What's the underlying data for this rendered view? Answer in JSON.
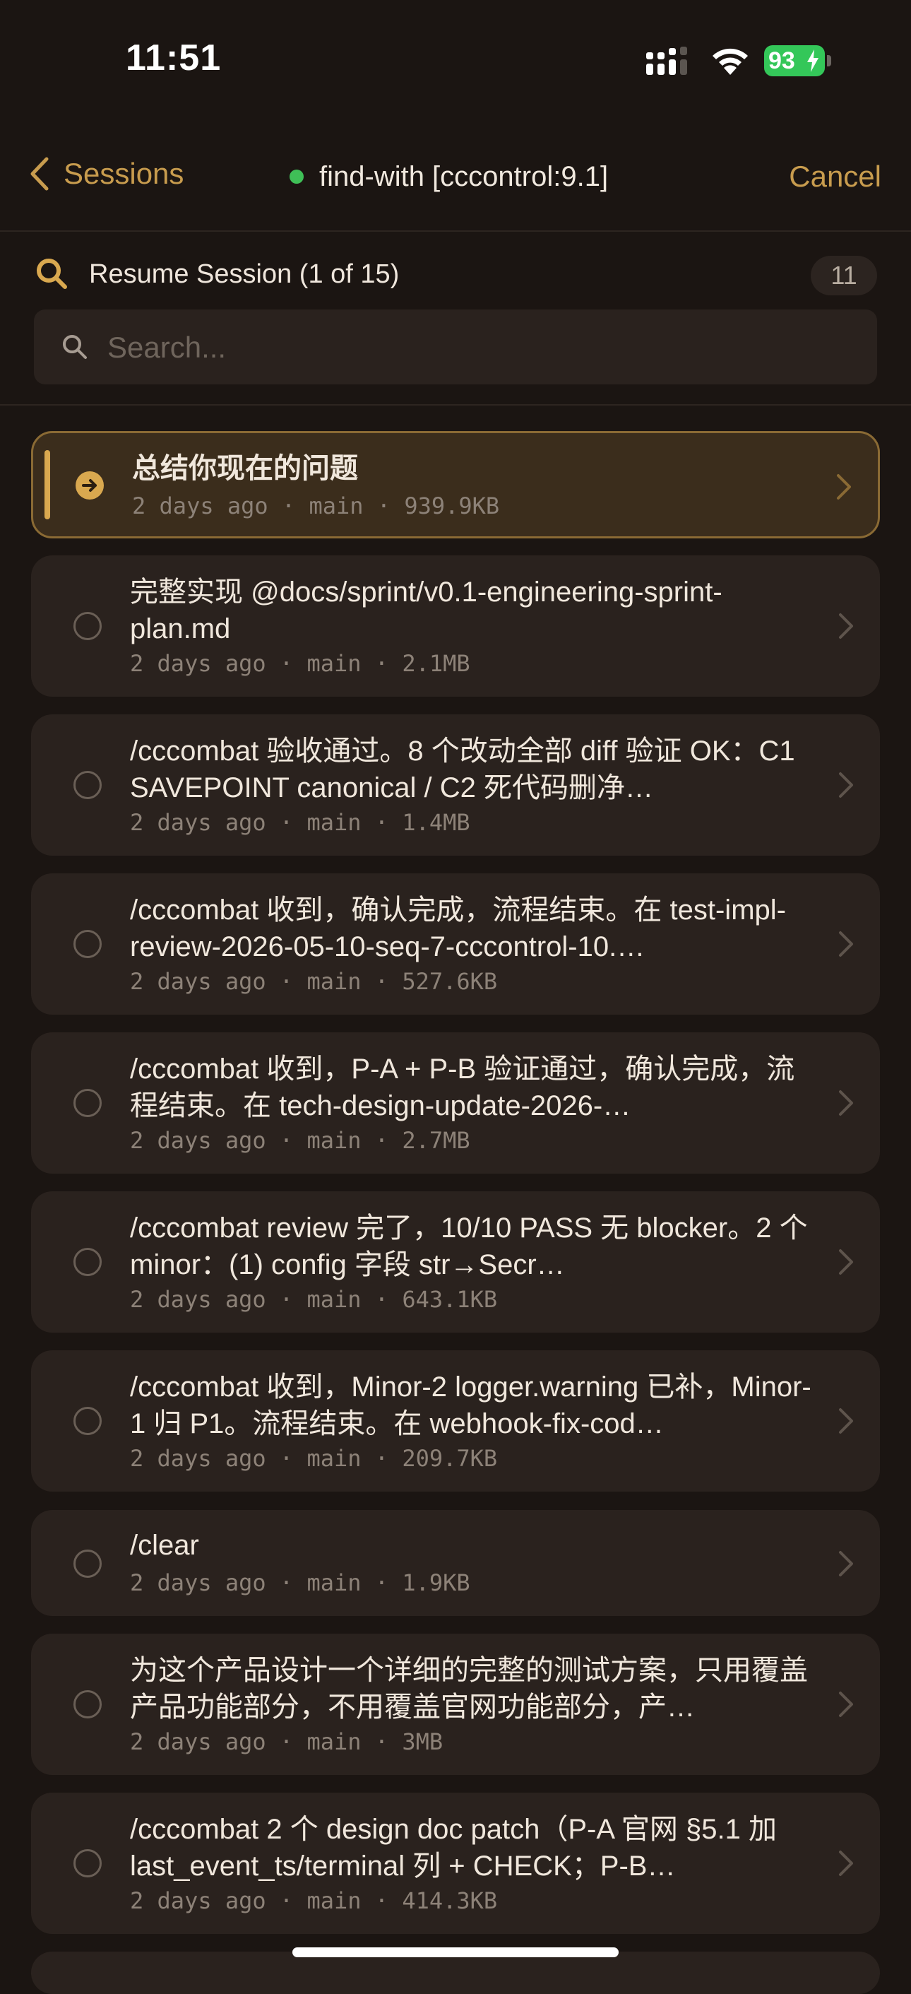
{
  "status_bar": {
    "time": "11:51",
    "battery": "93"
  },
  "nav": {
    "back_label": "Sessions",
    "title": "find-with [cccontrol:9.1]",
    "cancel_label": "Cancel"
  },
  "resume": {
    "title": "Resume Session (1 of 15)",
    "count": "11",
    "search_placeholder": "Search..."
  },
  "sessions": [
    {
      "title": "总结你现在的问题",
      "meta": "2 days ago · main · 939.9KB",
      "selected": true
    },
    {
      "title": "完整实现 @docs/sprint/v0.1-engineering-sprint-plan.md",
      "meta": "2 days ago · main · 2.1MB"
    },
    {
      "title": "/cccombat 验收通过。8 个改动全部 diff 验证 OK：C1 SAVEPOINT canonical / C2 死代码删净…",
      "meta": "2 days ago · main · 1.4MB"
    },
    {
      "title": "/cccombat 收到，确认完成，流程结束。在 test-impl-review-2026-05-10-seq-7-cccontrol-10.…",
      "meta": "2 days ago · main · 527.6KB"
    },
    {
      "title": "/cccombat 收到，P-A + P-B 验证通过，确认完成，流程结束。在 tech-design-update-2026-…",
      "meta": "2 days ago · main · 2.7MB"
    },
    {
      "title": "/cccombat review 完了，10/10 PASS 无 blocker。2 个 minor：(1) config 字段 str→Secr…",
      "meta": "2 days ago · main · 643.1KB"
    },
    {
      "title": "/cccombat 收到，Minor-2 logger.warning 已补，Minor-1 归 P1。流程结束。在 webhook-fix-cod…",
      "meta": "2 days ago · main · 209.7KB"
    },
    {
      "title": "/clear",
      "meta": "2 days ago · main · 1.9KB"
    },
    {
      "title": "为这个产品设计一个详细的完整的测试方案，只用覆盖产品功能部分，不用覆盖官网功能部分，产…",
      "meta": "2 days ago · main · 3MB"
    },
    {
      "title": "/cccombat 2 个 design doc patch（P-A 官网 §5.1 加 last_event_ts/terminal 列 + CHECK；P-B…",
      "meta": "2 days ago · main · 414.3KB"
    }
  ]
}
